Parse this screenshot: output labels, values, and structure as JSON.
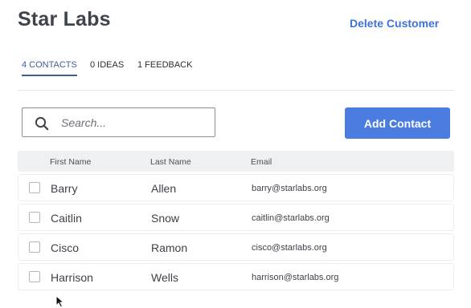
{
  "header": {
    "title": "Star Labs",
    "delete_label": "Delete Customer"
  },
  "tabs": [
    {
      "label": "4 CONTACTS",
      "active": true
    },
    {
      "label": "0 IDEAS",
      "active": false
    },
    {
      "label": "1 FEEDBACK",
      "active": false
    }
  ],
  "search": {
    "placeholder": "Search...",
    "value": ""
  },
  "add_contact_label": "Add Contact",
  "table": {
    "columns": [
      "First Name",
      "Last Name",
      "Email"
    ],
    "rows": [
      {
        "first": "Barry",
        "last": "Allen",
        "email": "barry@starlabs.org",
        "checked": false
      },
      {
        "first": "Caitlin",
        "last": "Snow",
        "email": "caitlin@starlabs.org",
        "checked": false
      },
      {
        "first": "Cisco",
        "last": "Ramon",
        "email": "cisco@starlabs.org",
        "checked": false
      },
      {
        "first": "Harrison",
        "last": "Wells",
        "email": "harrison@starlabs.org",
        "checked": false
      }
    ]
  },
  "colors": {
    "accent": "#4a7ddf",
    "link": "#3d72d8",
    "active_tab": "#3f5f95"
  },
  "icons": {
    "search": "search-icon",
    "cursor": "mouse-pointer-icon"
  }
}
